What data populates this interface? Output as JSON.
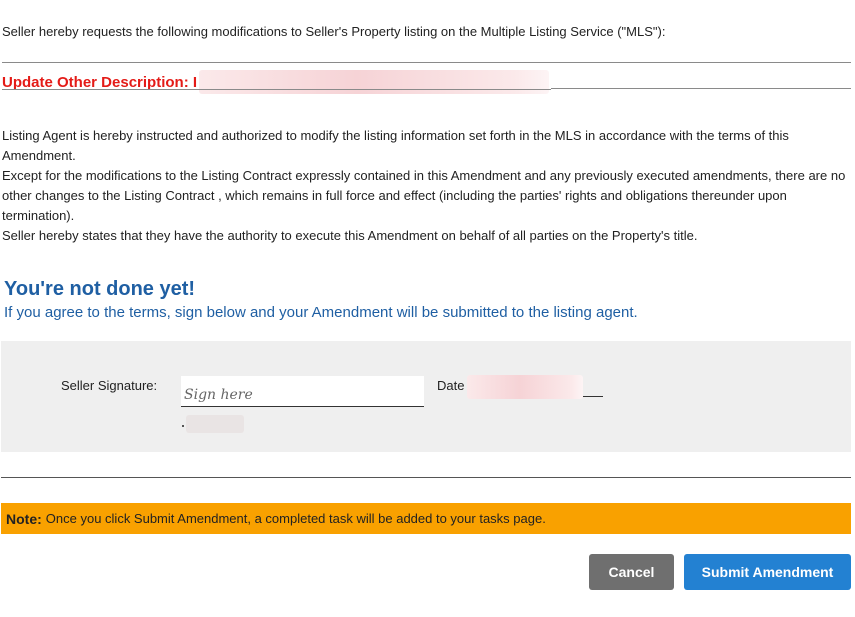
{
  "intro": "Seller hereby requests the following modifications to Seller's Property listing on the Multiple Listing Service (\"MLS\"):",
  "update": {
    "label": "Update Other Description: I"
  },
  "terms": [
    "Listing Agent is hereby instructed and authorized to modify the listing information set forth in the MLS in accordance with the terms of this Amendment.",
    "Except for the modifications to the Listing Contract expressly contained in this Amendment and any previously executed amendments, there are no other changes to the Listing Contract , which remains in full force and effect (including the parties' rights and obligations thereunder upon termination).",
    "Seller hereby states that they have the authority to execute this Amendment on behalf of all parties on the Property's title."
  ],
  "cta": {
    "title": "You're not done yet!",
    "subtitle": "If you agree to the terms, sign below and your Amendment will be submitted to the listing agent."
  },
  "signature": {
    "label": "Seller Signature:",
    "placeholder": "Sign here",
    "value": "",
    "date_label": "Date"
  },
  "note": {
    "bold": "Note:",
    "text": "Once you click Submit Amendment, a completed task will be added to your tasks page."
  },
  "buttons": {
    "cancel": "Cancel",
    "submit": "Submit Amendment"
  },
  "colors": {
    "accent_blue": "#1f5fa3",
    "update_red": "#e41b17",
    "note_orange": "#f9a100",
    "submit_blue": "#2381d2",
    "cancel_gray": "#6f6f6f"
  }
}
